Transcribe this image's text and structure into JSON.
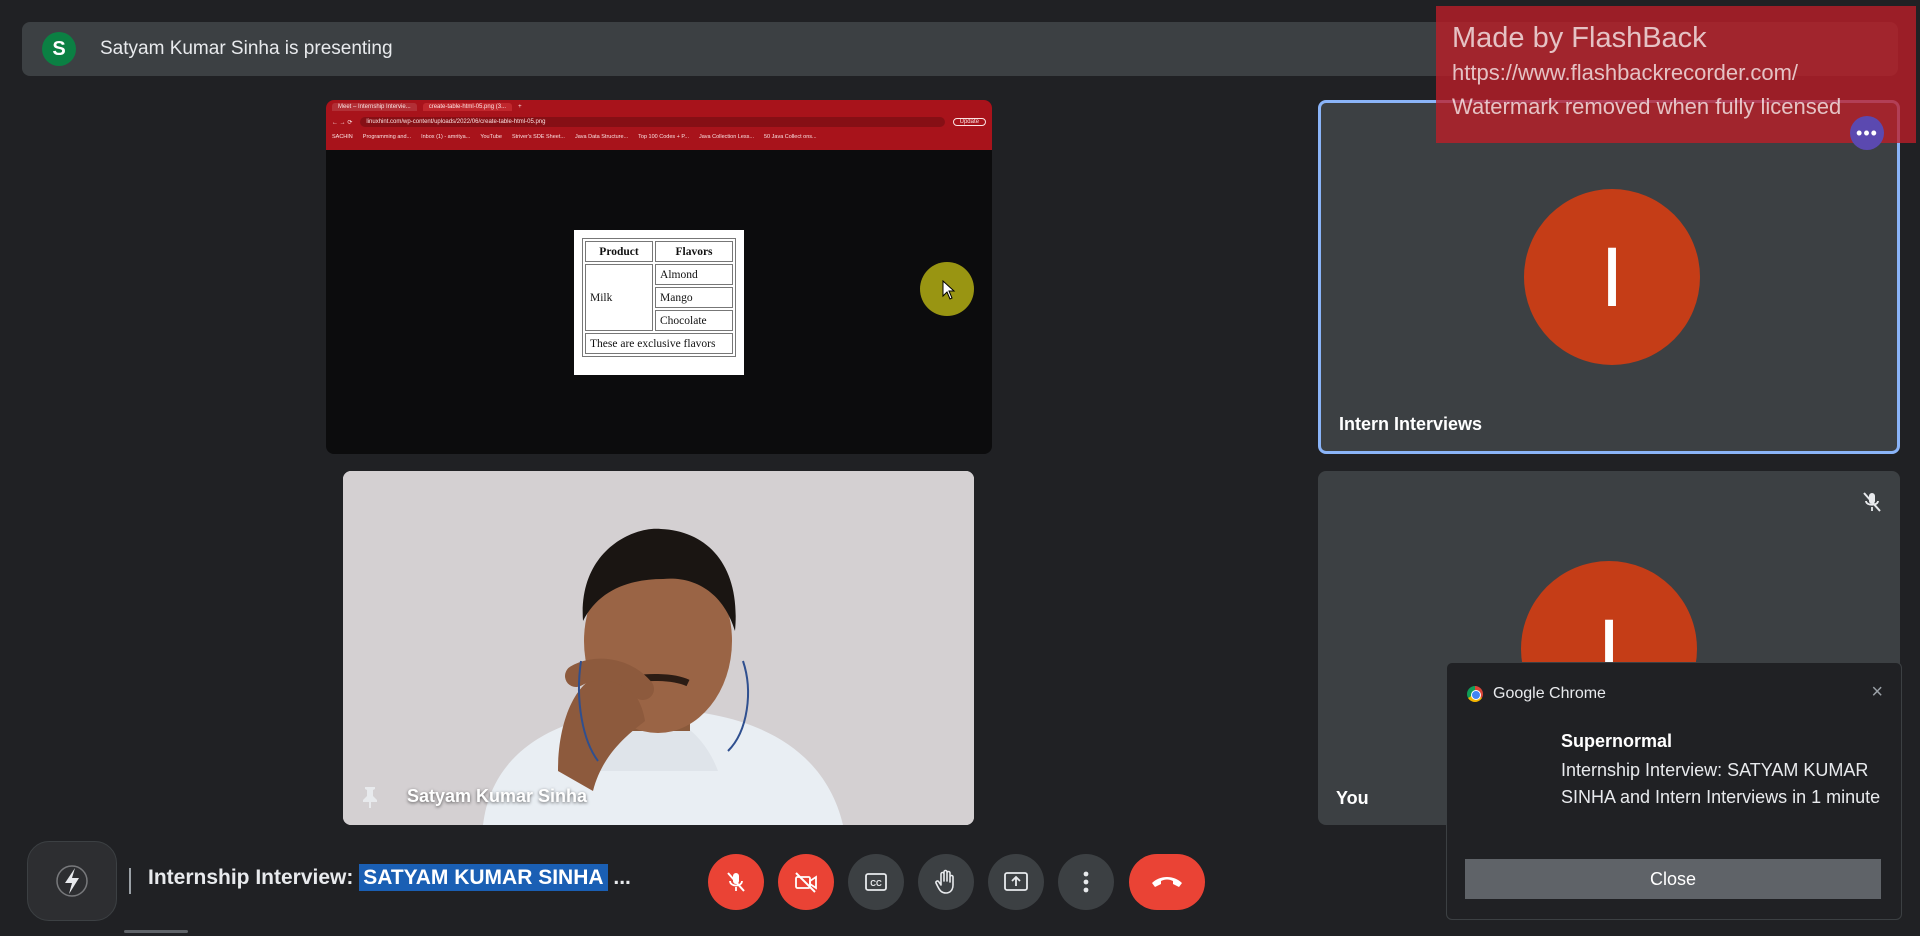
{
  "presenting_bar": {
    "avatar_letter": "S",
    "text": "Satyam Kumar Sinha is presenting"
  },
  "watermark": {
    "line1": "Made by FlashBack",
    "line2": "https://www.flashbackrecorder.com/",
    "line3": "Watermark removed when fully licensed"
  },
  "shared_screen": {
    "tabs": [
      "Meet – Internship Intervie...",
      "create-table-html-05.png (3..."
    ],
    "url": "linuxhint.com/wp-content/uploads/2022/06/create-table-html-05.png",
    "update_label": "Update",
    "bookmarks": [
      "SACHIN",
      "Programming and...",
      "Inbox (1) - amritya...",
      "YouTube",
      "Striver's SDE Sheet...",
      "Java Data Structure...",
      "Top 100 Codes + P...",
      "Java Collection Less...",
      "50 Java Collect ons..."
    ],
    "table": {
      "headers": [
        "Product",
        "Flavors"
      ],
      "product": "Milk",
      "flavors": [
        "Almond",
        "Mango",
        "Chocolate"
      ],
      "footer": "These are exclusive flavors"
    }
  },
  "camera_tile": {
    "name": "Satyam Kumar Sinha"
  },
  "right_tiles": [
    {
      "avatar_letter": "I",
      "name": "Intern Interviews"
    },
    {
      "avatar_letter": "I",
      "name": "You"
    }
  ],
  "notification": {
    "app": "Google Chrome",
    "close_x": "×",
    "title": "Supernormal",
    "body": "Internship Interview: SATYAM KUMAR SINHA and Intern Interviews in 1 minute",
    "button": "Close"
  },
  "meeting": {
    "title_prefix": "Internship Interview: ",
    "title_highlight": "SATYAM KUMAR SINHA",
    "title_suffix": " ..."
  },
  "controls": [
    "mic-off",
    "camera-off",
    "captions",
    "raise-hand",
    "present-screen",
    "more-options",
    "leave-call"
  ],
  "colors": {
    "background": "#202124",
    "tile": "#3c4043",
    "danger": "#ea4335",
    "accent_border": "#8ab4f8",
    "avatar": "#c53d17"
  }
}
